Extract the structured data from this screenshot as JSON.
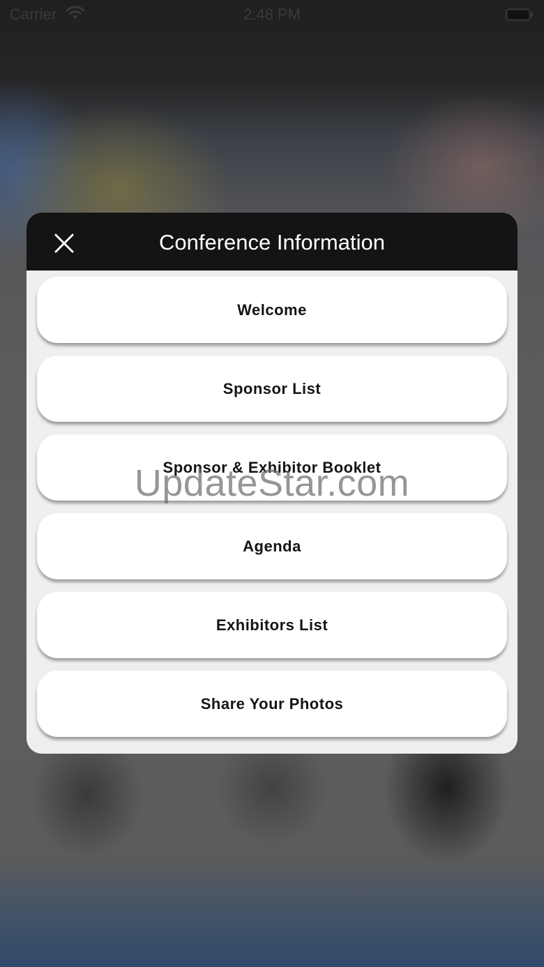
{
  "status_bar": {
    "carrier": "Carrier",
    "time": "2:48 PM",
    "wifi_icon": "wifi-icon",
    "battery_icon": "battery-icon"
  },
  "modal": {
    "title": "Conference Information",
    "close_icon": "close-icon",
    "header_color": "#141414",
    "background_color": "#efefef",
    "items": [
      {
        "label": "Welcome"
      },
      {
        "label": "Sponsor List"
      },
      {
        "label": "Sponsor & Exhibitor Booklet"
      },
      {
        "label": "Agenda"
      },
      {
        "label": "Exhibitors List"
      },
      {
        "label": "Share Your Photos"
      }
    ]
  },
  "watermark": "UpdateStar.com"
}
